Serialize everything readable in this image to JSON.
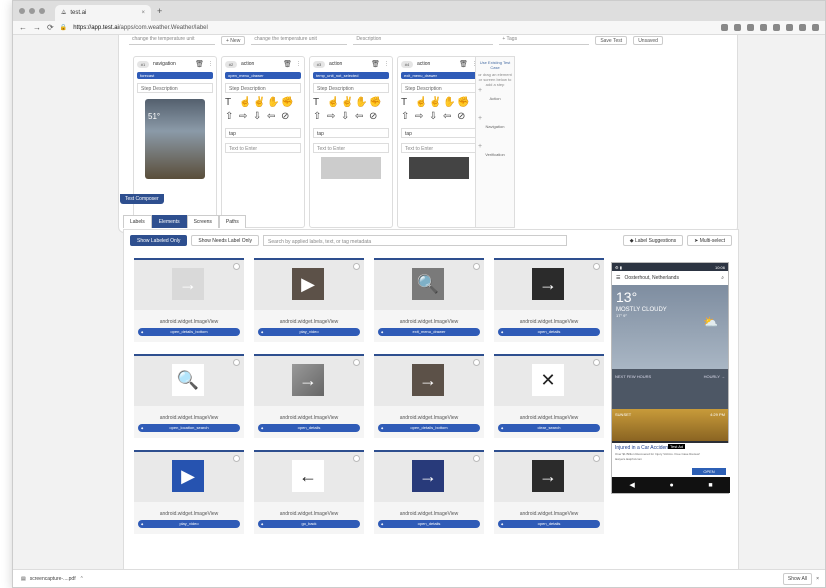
{
  "browser": {
    "tab_title": "test.ai",
    "tab_icon": "testai-logo-icon",
    "url_domain": "https://app.test.ai",
    "url_path": "/apps/com.weather.Weather/label"
  },
  "topstrip": {
    "field1": "change the temperature unit",
    "new_btn": "+ New",
    "field2": "change the temperature unit",
    "field3": "Description",
    "field4": "+ Tags",
    "btn_save": "Save Test",
    "btn_unsaved": "Unsaved"
  },
  "steps": [
    {
      "num": "#1",
      "type": "navigation",
      "pill": "forecast",
      "desc": "Step Description"
    },
    {
      "num": "#2",
      "type": "action",
      "pill": "open_menu_drawer",
      "desc": "Step Description",
      "verb": "tap",
      "text_placeholder": "Text to Enter"
    },
    {
      "num": "#3",
      "type": "action",
      "pill": "temp_unit_not_selected",
      "desc": "Step Description",
      "verb": "tap",
      "text_placeholder": "Text to Enter"
    },
    {
      "num": "#4",
      "type": "action",
      "pill": "exit_menu_drawer",
      "desc": "Step Description",
      "verb": "tap",
      "text_placeholder": "Text to Enter"
    }
  ],
  "sidepane": {
    "title": "Use Existing Test Case",
    "hint": "or drag an element or screen below to add a step",
    "items": [
      "Action",
      "Navigation",
      "Verification"
    ]
  },
  "phone_mini": {
    "temp": "51°"
  },
  "composer_tab": "Test Composer",
  "lower_tabs": [
    "Labels",
    "Elements",
    "Screens",
    "Paths"
  ],
  "filters": {
    "show_labeled": "Show Labeled Only",
    "show_needs": "Show Needs Label Only",
    "search_placeholder": "Search by applied labels, text, or tag metadata",
    "label_suggestions": "Label Suggestions",
    "multi_select": "Multi-select"
  },
  "cards": [
    {
      "cls": "android.widget.ImageView",
      "label": "open_details_bottom",
      "glyph": "→",
      "bg": "bg-light"
    },
    {
      "cls": "android.widget.ImageView",
      "label": "play_video",
      "glyph": "▶",
      "bg": "bg-brown"
    },
    {
      "cls": "android.widget.ImageView",
      "label": "exit_menu_drawer",
      "glyph": "🔍",
      "bg": "bg-gray"
    },
    {
      "cls": "android.widget.ImageView",
      "label": "open_details",
      "glyph": "→",
      "bg": "bg-dark"
    },
    {
      "cls": "android.widget.ImageView",
      "label": "open_location_search",
      "glyph": "🔍",
      "bg": "bg-white"
    },
    {
      "cls": "android.widget.ImageView",
      "label": "open_details",
      "glyph": "→",
      "bg": "bg-gradgray"
    },
    {
      "cls": "android.widget.ImageView",
      "label": "open_details_bottom",
      "glyph": "→",
      "bg": "bg-brown"
    },
    {
      "cls": "android.widget.ImageView",
      "label": "clear_search",
      "glyph": "✕",
      "bg": "bg-white"
    },
    {
      "cls": "android.widget.ImageView",
      "label": "play_video",
      "glyph": "▶",
      "bg": "bg-blue"
    },
    {
      "cls": "android.widget.ImageView",
      "label": "go_back",
      "glyph": "←",
      "bg": "bg-white"
    },
    {
      "cls": "android.widget.ImageView",
      "label": "open_details",
      "glyph": "→",
      "bg": "bg-navy"
    },
    {
      "cls": "android.widget.ImageView",
      "label": "open_details",
      "glyph": "→",
      "bg": "bg-dark"
    }
  ],
  "phone": {
    "time": "10:06",
    "location": "Oosterhout, Netherlands",
    "temp": "13°",
    "condition": "MOSTLY CLOUDY",
    "hilo": "17° 9°",
    "hours_title": "NEXT FEW HOURS",
    "hourly": "HOURLY →",
    "sunset": "SUNSET",
    "sunset_time": "4:29 PM",
    "ad_title": "Injured in a Car Accident?",
    "ad_sub": "Over $1 Billion Recovered for Injury Victims. Free Case Review!",
    "ad_tag": "Test Ad",
    "ad_domain": "lawyers.lawphd.com",
    "ad_open": "OPEN"
  },
  "downloads": {
    "file": "screencapture-....pdf",
    "show_all": "Show All"
  }
}
